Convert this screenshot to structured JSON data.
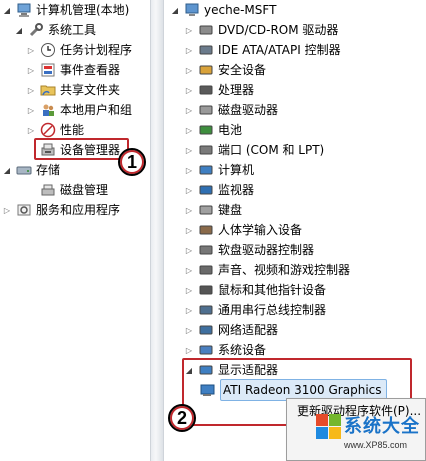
{
  "left_tree": {
    "root": "计算机管理(本地)",
    "system_tools": "系统工具",
    "task_scheduler": "任务计划程序",
    "event_viewer": "事件查看器",
    "shared_folders": "共享文件夹",
    "local_users_groups": "本地用户和组",
    "performance": "性能",
    "device_manager": "设备管理器",
    "storage": "存储",
    "disk_management": "磁盘管理",
    "services_apps": "服务和应用程序"
  },
  "right_tree": {
    "computer_name": "yeche-MSFT",
    "categories": [
      "DVD/CD-ROM 驱动器",
      "IDE ATA/ATAPI 控制器",
      "安全设备",
      "处理器",
      "磁盘驱动器",
      "电池",
      "端口 (COM 和 LPT)",
      "计算机",
      "监视器",
      "键盘",
      "人体学输入设备",
      "软盘驱动器控制器",
      "声音、视频和游戏控制器",
      "鼠标和其他指针设备",
      "通用串行总线控制器",
      "网络适配器",
      "系统设备",
      "显示适配器"
    ],
    "display_device": "ATI Radeon 3100 Graphics"
  },
  "context_menu": {
    "update_driver": "更新驱动程序软件(P)..."
  },
  "callouts": {
    "step1": "1",
    "step2": "2"
  },
  "watermark": {
    "title": "系统大全",
    "url": "www.XP85.com"
  },
  "colors": {
    "callout_red": "#c0282d",
    "selection_blue": "#dceaf8",
    "watermark_blue": "#1a73c8"
  }
}
